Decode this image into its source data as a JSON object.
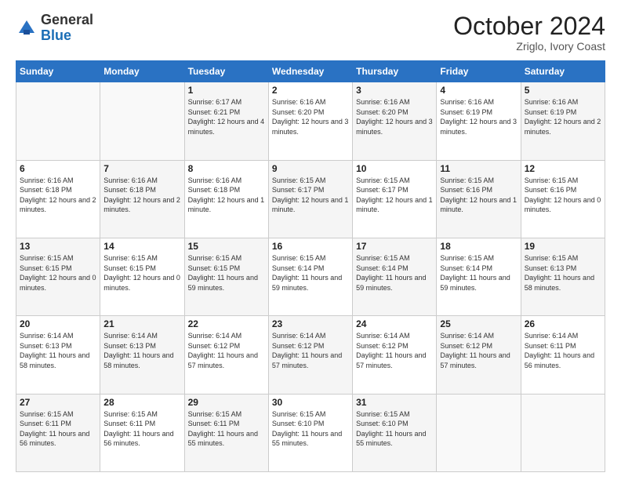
{
  "header": {
    "logo_general": "General",
    "logo_blue": "Blue",
    "month_title": "October 2024",
    "subtitle": "Zriglo, Ivory Coast"
  },
  "weekdays": [
    "Sunday",
    "Monday",
    "Tuesday",
    "Wednesday",
    "Thursday",
    "Friday",
    "Saturday"
  ],
  "weeks": [
    [
      {
        "day": "",
        "sunrise": "",
        "sunset": "",
        "daylight": ""
      },
      {
        "day": "",
        "sunrise": "",
        "sunset": "",
        "daylight": ""
      },
      {
        "day": "1",
        "sunrise": "Sunrise: 6:17 AM",
        "sunset": "Sunset: 6:21 PM",
        "daylight": "Daylight: 12 hours and 4 minutes."
      },
      {
        "day": "2",
        "sunrise": "Sunrise: 6:16 AM",
        "sunset": "Sunset: 6:20 PM",
        "daylight": "Daylight: 12 hours and 3 minutes."
      },
      {
        "day": "3",
        "sunrise": "Sunrise: 6:16 AM",
        "sunset": "Sunset: 6:20 PM",
        "daylight": "Daylight: 12 hours and 3 minutes."
      },
      {
        "day": "4",
        "sunrise": "Sunrise: 6:16 AM",
        "sunset": "Sunset: 6:19 PM",
        "daylight": "Daylight: 12 hours and 3 minutes."
      },
      {
        "day": "5",
        "sunrise": "Sunrise: 6:16 AM",
        "sunset": "Sunset: 6:19 PM",
        "daylight": "Daylight: 12 hours and 2 minutes."
      }
    ],
    [
      {
        "day": "6",
        "sunrise": "Sunrise: 6:16 AM",
        "sunset": "Sunset: 6:18 PM",
        "daylight": "Daylight: 12 hours and 2 minutes."
      },
      {
        "day": "7",
        "sunrise": "Sunrise: 6:16 AM",
        "sunset": "Sunset: 6:18 PM",
        "daylight": "Daylight: 12 hours and 2 minutes."
      },
      {
        "day": "8",
        "sunrise": "Sunrise: 6:16 AM",
        "sunset": "Sunset: 6:18 PM",
        "daylight": "Daylight: 12 hours and 1 minute."
      },
      {
        "day": "9",
        "sunrise": "Sunrise: 6:15 AM",
        "sunset": "Sunset: 6:17 PM",
        "daylight": "Daylight: 12 hours and 1 minute."
      },
      {
        "day": "10",
        "sunrise": "Sunrise: 6:15 AM",
        "sunset": "Sunset: 6:17 PM",
        "daylight": "Daylight: 12 hours and 1 minute."
      },
      {
        "day": "11",
        "sunrise": "Sunrise: 6:15 AM",
        "sunset": "Sunset: 6:16 PM",
        "daylight": "Daylight: 12 hours and 1 minute."
      },
      {
        "day": "12",
        "sunrise": "Sunrise: 6:15 AM",
        "sunset": "Sunset: 6:16 PM",
        "daylight": "Daylight: 12 hours and 0 minutes."
      }
    ],
    [
      {
        "day": "13",
        "sunrise": "Sunrise: 6:15 AM",
        "sunset": "Sunset: 6:15 PM",
        "daylight": "Daylight: 12 hours and 0 minutes."
      },
      {
        "day": "14",
        "sunrise": "Sunrise: 6:15 AM",
        "sunset": "Sunset: 6:15 PM",
        "daylight": "Daylight: 12 hours and 0 minutes."
      },
      {
        "day": "15",
        "sunrise": "Sunrise: 6:15 AM",
        "sunset": "Sunset: 6:15 PM",
        "daylight": "Daylight: 11 hours and 59 minutes."
      },
      {
        "day": "16",
        "sunrise": "Sunrise: 6:15 AM",
        "sunset": "Sunset: 6:14 PM",
        "daylight": "Daylight: 11 hours and 59 minutes."
      },
      {
        "day": "17",
        "sunrise": "Sunrise: 6:15 AM",
        "sunset": "Sunset: 6:14 PM",
        "daylight": "Daylight: 11 hours and 59 minutes."
      },
      {
        "day": "18",
        "sunrise": "Sunrise: 6:15 AM",
        "sunset": "Sunset: 6:14 PM",
        "daylight": "Daylight: 11 hours and 59 minutes."
      },
      {
        "day": "19",
        "sunrise": "Sunrise: 6:15 AM",
        "sunset": "Sunset: 6:13 PM",
        "daylight": "Daylight: 11 hours and 58 minutes."
      }
    ],
    [
      {
        "day": "20",
        "sunrise": "Sunrise: 6:14 AM",
        "sunset": "Sunset: 6:13 PM",
        "daylight": "Daylight: 11 hours and 58 minutes."
      },
      {
        "day": "21",
        "sunrise": "Sunrise: 6:14 AM",
        "sunset": "Sunset: 6:13 PM",
        "daylight": "Daylight: 11 hours and 58 minutes."
      },
      {
        "day": "22",
        "sunrise": "Sunrise: 6:14 AM",
        "sunset": "Sunset: 6:12 PM",
        "daylight": "Daylight: 11 hours and 57 minutes."
      },
      {
        "day": "23",
        "sunrise": "Sunrise: 6:14 AM",
        "sunset": "Sunset: 6:12 PM",
        "daylight": "Daylight: 11 hours and 57 minutes."
      },
      {
        "day": "24",
        "sunrise": "Sunrise: 6:14 AM",
        "sunset": "Sunset: 6:12 PM",
        "daylight": "Daylight: 11 hours and 57 minutes."
      },
      {
        "day": "25",
        "sunrise": "Sunrise: 6:14 AM",
        "sunset": "Sunset: 6:12 PM",
        "daylight": "Daylight: 11 hours and 57 minutes."
      },
      {
        "day": "26",
        "sunrise": "Sunrise: 6:14 AM",
        "sunset": "Sunset: 6:11 PM",
        "daylight": "Daylight: 11 hours and 56 minutes."
      }
    ],
    [
      {
        "day": "27",
        "sunrise": "Sunrise: 6:15 AM",
        "sunset": "Sunset: 6:11 PM",
        "daylight": "Daylight: 11 hours and 56 minutes."
      },
      {
        "day": "28",
        "sunrise": "Sunrise: 6:15 AM",
        "sunset": "Sunset: 6:11 PM",
        "daylight": "Daylight: 11 hours and 56 minutes."
      },
      {
        "day": "29",
        "sunrise": "Sunrise: 6:15 AM",
        "sunset": "Sunset: 6:11 PM",
        "daylight": "Daylight: 11 hours and 55 minutes."
      },
      {
        "day": "30",
        "sunrise": "Sunrise: 6:15 AM",
        "sunset": "Sunset: 6:10 PM",
        "daylight": "Daylight: 11 hours and 55 minutes."
      },
      {
        "day": "31",
        "sunrise": "Sunrise: 6:15 AM",
        "sunset": "Sunset: 6:10 PM",
        "daylight": "Daylight: 11 hours and 55 minutes."
      },
      {
        "day": "",
        "sunrise": "",
        "sunset": "",
        "daylight": ""
      },
      {
        "day": "",
        "sunrise": "",
        "sunset": "",
        "daylight": ""
      }
    ]
  ]
}
